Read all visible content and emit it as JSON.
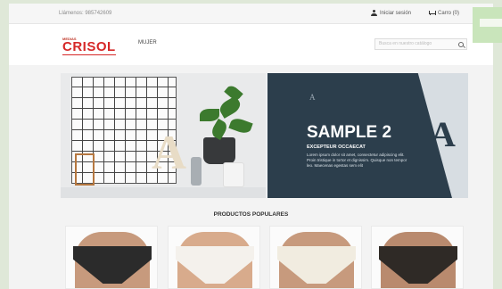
{
  "topbar": {
    "phone": "Llámenos: 985742609",
    "signin_label": "Iniciar sesión",
    "cart_label": "Carro (0)"
  },
  "header": {
    "logo_small": "MEDIAS",
    "logo_text": "CRISOL",
    "nav": [
      {
        "label": "MUJER"
      }
    ],
    "search_placeholder": "Busca en nuestro catálogo"
  },
  "banner": {
    "title": "SAMPLE 2",
    "subtitle": "EXCEPTEUR OCCAECAT",
    "body": "Lorem ipsum dolor sit amet, consectetur adipiscing elit. Proin tristique in tortor et dignissim. Quisque non tempor leo. Maecenas egestas sem elit",
    "big_letter": "A"
  },
  "section_title": "PRODUCTOS POPULARES",
  "products": [
    {
      "color": "#2b2b2b",
      "skin": "#c79a7d"
    },
    {
      "color": "#f4f1ec",
      "skin": "#d8ab8c"
    },
    {
      "color": "#f1ece0",
      "skin": "#c79a7d"
    },
    {
      "color": "#2f2a26",
      "skin": "#b98a6e"
    }
  ],
  "colors": {
    "brand": "#d62828",
    "banner_dark": "#2c3e4c",
    "accent_green": "#c9e5bb"
  }
}
